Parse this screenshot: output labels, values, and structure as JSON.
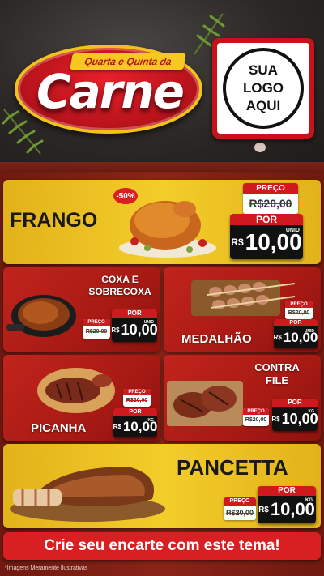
{
  "header": {
    "subtitle": "Quarta e Quinta da",
    "title": "Carne",
    "logo_lines": [
      "SUA",
      "LOGO",
      "AQUI"
    ]
  },
  "products": {
    "frango": {
      "name": "FRANGO",
      "badge": "-50%",
      "preco_label": "PREÇO",
      "old_price": "R$20,00",
      "por_label": "POR",
      "currency": "R$",
      "price": "10,00",
      "unit": "UNID"
    },
    "coxa": {
      "name_line1": "COXA E",
      "name_line2": "SOBRECOXA",
      "preco_label": "PREÇO",
      "old_price": "R$20,00",
      "por_label": "POR",
      "currency": "R$",
      "price": "10,00",
      "unit": "UNID"
    },
    "medalhao": {
      "name": "MEDALHÃO",
      "preco_label": "PREÇO",
      "old_price": "R$20,00",
      "por_label": "POR",
      "currency": "R$",
      "price": "10,00",
      "unit": "UNID"
    },
    "picanha": {
      "name": "PICANHA",
      "preco_label": "PREÇO",
      "old_price": "R$20,00",
      "por_label": "POR",
      "currency": "R$",
      "price": "10,00",
      "unit": "KG"
    },
    "contrafile": {
      "name_line1": "CONTRA",
      "name_line2": "FILE",
      "preco_label": "PREÇO",
      "old_price": "R$20,00",
      "por_label": "POR",
      "currency": "R$",
      "price": "10,00",
      "unit": "KG"
    },
    "pancetta": {
      "name": "PANCETTA",
      "preco_label": "PREÇO",
      "old_price": "R$20,00",
      "por_label": "POR",
      "currency": "R$",
      "price": "10,00",
      "unit": "KG"
    }
  },
  "cta": "Crie seu encarte com este tema!",
  "footnote": "*Imagens Meramente Ilustrativas",
  "colors": {
    "accent_red": "#d0181f",
    "yellow": "#f3cd2a",
    "dark": "#111111"
  }
}
